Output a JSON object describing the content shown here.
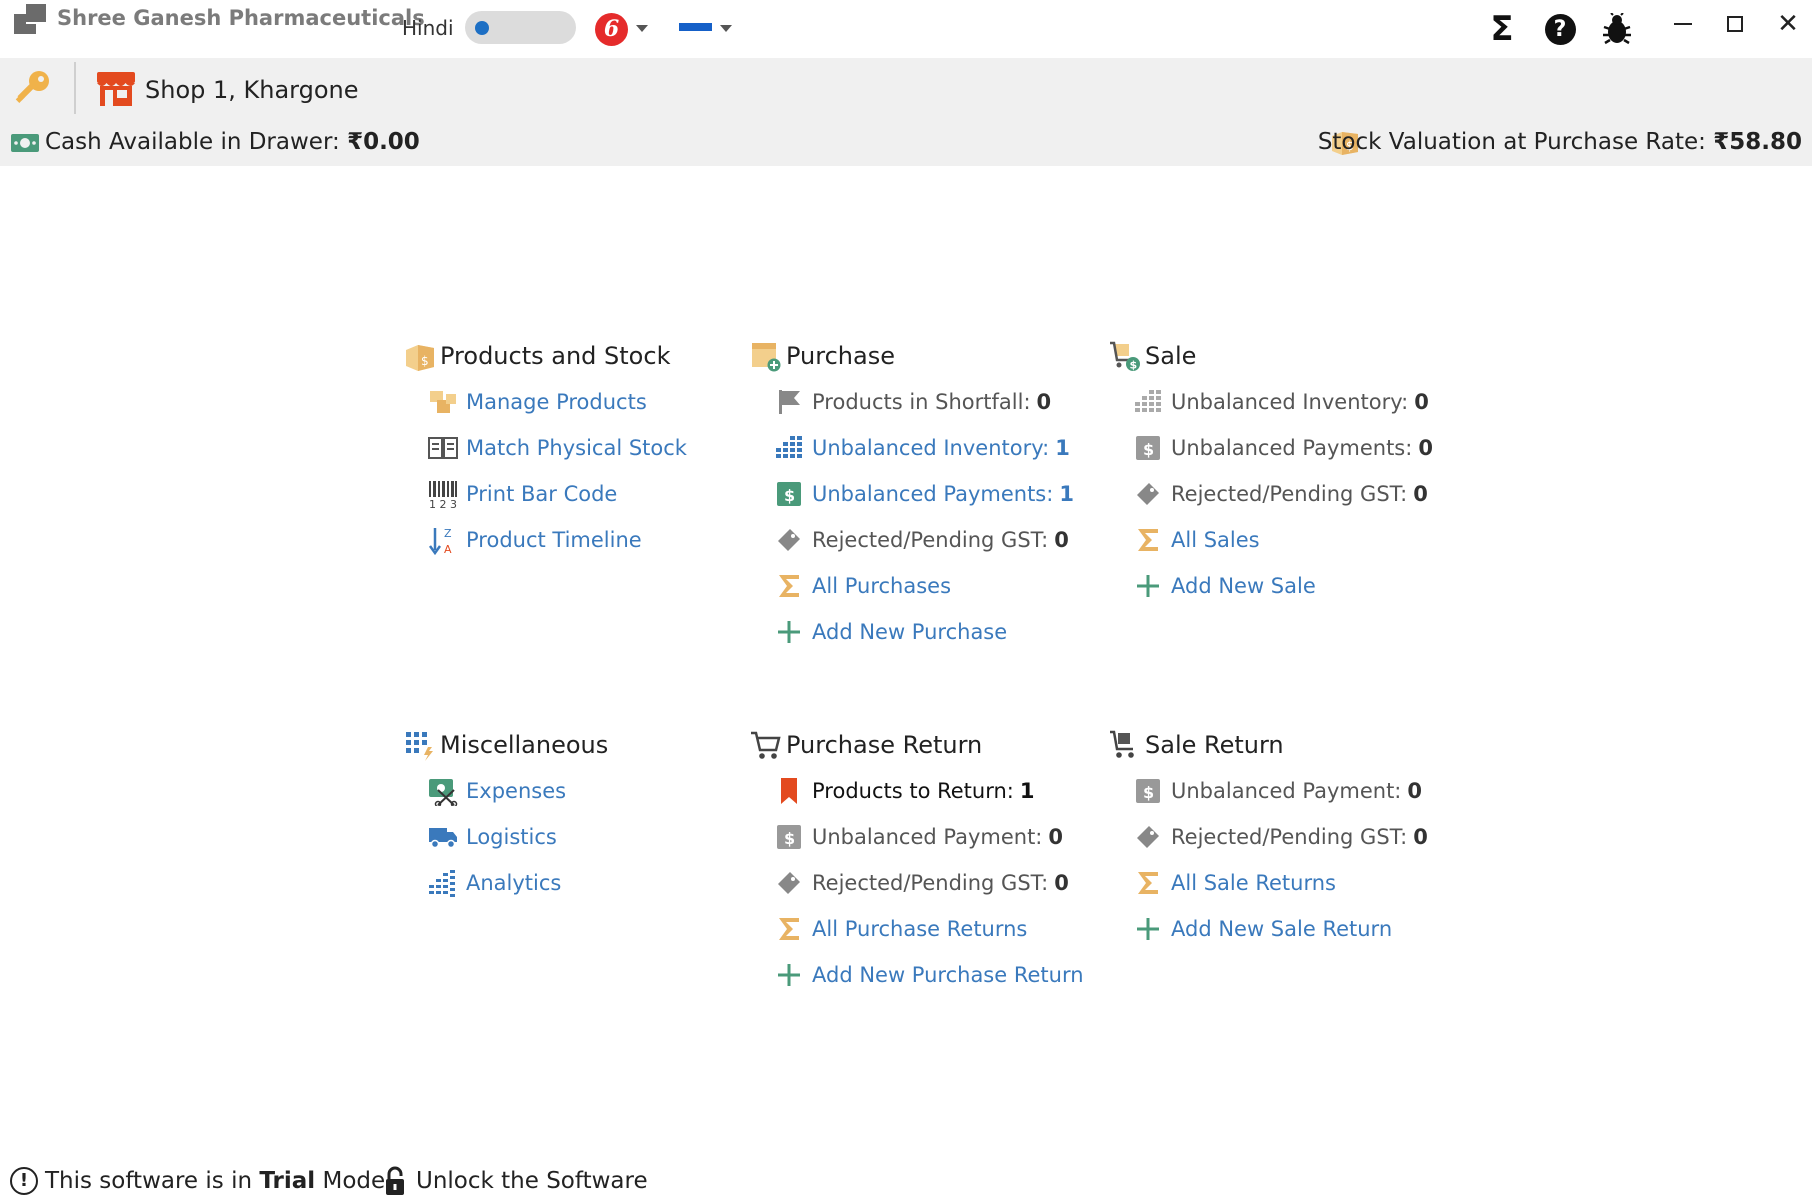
{
  "app": {
    "title": "Shree Ganesh Pharmaceuticals",
    "language_label": "Hindi",
    "brand_icon_letter": "6",
    "toolbar": {
      "sigma_symbol": "Σ",
      "help_symbol": "?",
      "close_symbol": "✕"
    }
  },
  "shop": {
    "name": "Shop 1, Khargone",
    "cash_label": "Cash Available in Drawer:",
    "cash_value": "₹0.00",
    "stock_label": "Stock Valuation at Purchase Rate:",
    "stock_value": "₹58.80"
  },
  "sections": {
    "products": {
      "title": "Products and Stock",
      "items": [
        {
          "label": "Manage Products",
          "icon": "boxes-icon"
        },
        {
          "label": "Match Physical Stock",
          "icon": "book-icon"
        },
        {
          "label": "Print Bar Code",
          "icon": "barcode-icon"
        },
        {
          "label": "Product Timeline",
          "icon": "sort-icon"
        }
      ]
    },
    "purchase": {
      "title": "Purchase",
      "items": [
        {
          "label": "Products in Shortfall:",
          "count": "0",
          "icon": "flag-icon"
        },
        {
          "label": "Unbalanced Inventory:",
          "count": "1",
          "icon": "inventory-icon"
        },
        {
          "label": "Unbalanced Payments:",
          "count": "1",
          "icon": "dollar-icon"
        },
        {
          "label": "Rejected/Pending GST:",
          "count": "0",
          "icon": "tag-icon"
        },
        {
          "label": "All Purchases",
          "icon": "sigma-icon"
        },
        {
          "label": "Add New Purchase",
          "icon": "plus-icon"
        }
      ]
    },
    "sale": {
      "title": "Sale",
      "items": [
        {
          "label": "Unbalanced Inventory:",
          "count": "0",
          "icon": "inventory-icon"
        },
        {
          "label": "Unbalanced Payments:",
          "count": "0",
          "icon": "dollar-icon"
        },
        {
          "label": "Rejected/Pending GST:",
          "count": "0",
          "icon": "tag-icon"
        },
        {
          "label": "All Sales",
          "icon": "sigma-icon"
        },
        {
          "label": "Add New Sale",
          "icon": "plus-icon"
        }
      ]
    },
    "misc": {
      "title": "Miscellaneous",
      "items": [
        {
          "label": "Expenses",
          "icon": "expenses-icon"
        },
        {
          "label": "Logistics",
          "icon": "truck-icon"
        },
        {
          "label": "Analytics",
          "icon": "analytics-icon"
        }
      ]
    },
    "purchase_return": {
      "title": "Purchase Return",
      "items": [
        {
          "label": "Products to Return:",
          "count": "1",
          "icon": "bookmark-icon"
        },
        {
          "label": "Unbalanced Payment:",
          "count": "0",
          "icon": "dollar-icon"
        },
        {
          "label": "Rejected/Pending GST:",
          "count": "0",
          "icon": "tag-icon"
        },
        {
          "label": "All Purchase Returns",
          "icon": "sigma-icon"
        },
        {
          "label": "Add New Purchase Return",
          "icon": "plus-icon"
        }
      ]
    },
    "sale_return": {
      "title": "Sale Return",
      "items": [
        {
          "label": "Unbalanced Payment:",
          "count": "0",
          "icon": "dollar-icon"
        },
        {
          "label": "Rejected/Pending GST:",
          "count": "0",
          "icon": "tag-icon"
        },
        {
          "label": "All Sale Returns",
          "icon": "sigma-icon"
        },
        {
          "label": "Add New Sale Return",
          "icon": "plus-icon"
        }
      ]
    }
  },
  "footer": {
    "trial_prefix": "This software is in",
    "trial_bold": "Trial",
    "trial_suffix": "Mode",
    "trial_icon": "!",
    "unlock_label": "Unlock the Software"
  },
  "colors": {
    "link": "#3a79bc",
    "accent_red": "#e34a1f",
    "accent_orange": "#e8b363",
    "accent_green": "#4a9a7a",
    "bar_bg": "#f0f0f0"
  }
}
